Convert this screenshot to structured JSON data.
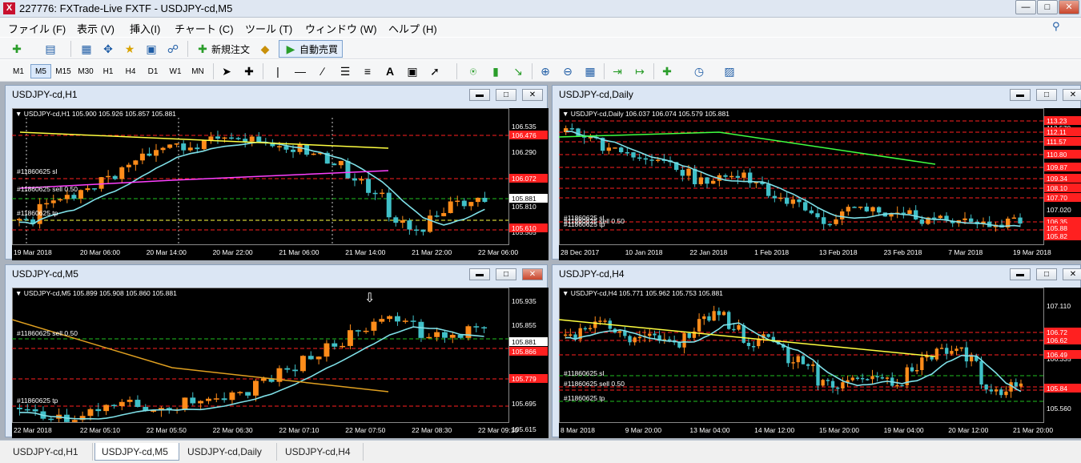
{
  "window": {
    "title": "227776: FXTrade-Live FXTF - USDJPY-cd,M5",
    "icon": "app-icon"
  },
  "menu": [
    "ファイル (F)",
    "表示 (V)",
    "挿入(I)",
    "チャート (C)",
    "ツール (T)",
    "ウィンドウ (W)",
    "ヘルプ (H)"
  ],
  "toolbar": {
    "new_order": "新規注文",
    "auto_trade": "自動売買"
  },
  "timeframes": [
    "M1",
    "M5",
    "M15",
    "M30",
    "H1",
    "H4",
    "D1",
    "W1",
    "MN"
  ],
  "drawing_tools": {
    "text_tool": "A"
  },
  "active_timeframe": "M5",
  "charts": [
    {
      "id": "h1",
      "title": "USDJPY-cd,H1",
      "header": "USDJPY-cd,H1  105.900 105.926 105.857 105.881",
      "price_labels": [
        "106.535",
        "106.290",
        "105.810",
        "105.565"
      ],
      "highlight_labels": [
        "106.476",
        "106.072",
        "105.881",
        "105.610"
      ],
      "order_labels": [
        "#11860625 sl",
        "#11860625 sell 0.50",
        "#11860625 tp"
      ],
      "time_labels": [
        "19 Mar 2018",
        "20 Mar 06:00",
        "20 Mar 14:00",
        "20 Mar 22:00",
        "21 Mar 06:00",
        "21 Mar 14:00",
        "21 Mar 22:00",
        "22 Mar 06:00"
      ]
    },
    {
      "id": "daily",
      "title": "USDJPY-cd,Daily",
      "header": "USDJPY-cd,Daily  106.037 106.074 105.579 105.881",
      "price_labels": [
        "112.570",
        "107.020"
      ],
      "highlight_labels": [
        "113.23",
        "112.11",
        "111.57",
        "110.80",
        "109.87",
        "109.34",
        "108.10",
        "107.70",
        "106.35",
        "105.88",
        "105.82"
      ],
      "order_labels": [
        "#11860625 sl",
        "#11860625 sell 0.50",
        "#11860625 tp"
      ],
      "time_labels": [
        "28 Dec 2017",
        "10 Jan 2018",
        "22 Jan 2018",
        "1 Feb 2018",
        "13 Feb 2018",
        "23 Feb 2018",
        "7 Mar 2018",
        "19 Mar 2018"
      ]
    },
    {
      "id": "m5",
      "title": "USDJPY-cd,M5",
      "header": "USDJPY-cd,M5  105.899 105.908 105.860 105.881",
      "price_labels": [
        "105.935",
        "105.855",
        "105.695",
        "105.615"
      ],
      "highlight_labels": [
        "105.881",
        "105.866",
        "105.779"
      ],
      "order_labels": [
        "#11860625 sell 0.50",
        "#11860625 tp"
      ],
      "time_labels": [
        "22 Mar 2018",
        "22 Mar 05:10",
        "22 Mar 05:50",
        "22 Mar 06:30",
        "22 Mar 07:10",
        "22 Mar 07:50",
        "22 Mar 08:30",
        "22 Mar 09:10"
      ]
    },
    {
      "id": "h4",
      "title": "USDJPY-cd,H4",
      "header": "USDJPY-cd,H4  105.771 105.962 105.753 105.881",
      "price_labels": [
        "107.110",
        "106.335",
        "105.560"
      ],
      "highlight_labels": [
        "106.72",
        "106.62",
        "106.49",
        "105.84"
      ],
      "order_labels": [
        "#11860625 sl",
        "#11860625 sell 0.50",
        "#11860625 tp"
      ],
      "time_labels": [
        "8 Mar 2018",
        "9 Mar 20:00",
        "13 Mar 04:00",
        "14 Mar 12:00",
        "15 Mar 20:00",
        "19 Mar 04:00",
        "20 Mar 12:00",
        "21 Mar 20:00"
      ]
    }
  ],
  "tabs": [
    "USDJPY-cd,H1",
    "USDJPY-cd,M5",
    "USDJPY-cd,Daily",
    "USDJPY-cd,H4"
  ],
  "active_tab": "USDJPY-cd,M5",
  "colors": {
    "bull": "#ff8c1a",
    "bear": "#40c0c8",
    "ma_fast": "#7fe0e8",
    "yellow_ma": "#ffff40",
    "magenta_ma": "#ff40ff",
    "green_ma": "#40ff40",
    "level_red": "#ff2020",
    "level_green": "#20c020"
  }
}
